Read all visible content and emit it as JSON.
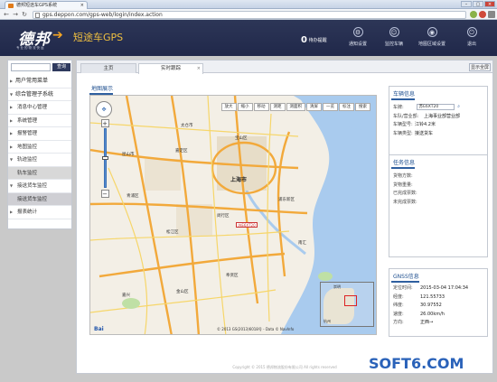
{
  "browser": {
    "tab_title": "德邦短途车GPS系统",
    "tab_close": "×",
    "url": "gps.deppon.com/gps-web/login/index.action",
    "window_buttons": [
      "–",
      "▢",
      "×"
    ],
    "nav": [
      "←",
      "→",
      "↻"
    ]
  },
  "header": {
    "logo": "德邦",
    "logo_sub": "专业的物流快运",
    "app_name": "短途车GPS",
    "notice_count": "0",
    "notice_label": "待办提醒",
    "items": [
      {
        "label": "通知设置",
        "icon": "bell-icon",
        "glyph": "⚙"
      },
      {
        "label": "监控车辆",
        "icon": "person-icon",
        "glyph": "👤"
      },
      {
        "label": "地图区域设置",
        "icon": "map-pin-icon",
        "glyph": "◉"
      },
      {
        "label": "退出",
        "icon": "power-icon",
        "glyph": "⏻"
      }
    ]
  },
  "sidebar": {
    "search_button": "查询",
    "items": [
      {
        "label": "用户常用菜单",
        "level": "parent",
        "arrow": "▶"
      },
      {
        "label": "综合管理子系统",
        "level": "parent",
        "arrow": "▼"
      },
      {
        "label": "消息中心管理",
        "level": "sub",
        "arrow": "▶"
      },
      {
        "label": "系统管理",
        "level": "sub",
        "arrow": "▶"
      },
      {
        "label": "报警管理",
        "level": "sub",
        "arrow": "▶"
      },
      {
        "label": "地图监控",
        "level": "sub",
        "arrow": "▶"
      },
      {
        "label": "轨迹监控",
        "level": "sub",
        "arrow": "▼"
      },
      {
        "label": "轨车监控",
        "level": "leaf-active",
        "arrow": ""
      },
      {
        "label": "接送货车监控",
        "level": "sub",
        "arrow": "▼"
      },
      {
        "label": "接送货车监控",
        "level": "leaf-active2",
        "arrow": ""
      },
      {
        "label": "报表统计",
        "level": "sub",
        "arrow": "▶"
      }
    ]
  },
  "content": {
    "tabs": [
      {
        "label": "主页",
        "active": false
      },
      {
        "label": "实时跟踪",
        "active": true
      }
    ],
    "tab_close": "×",
    "fullscreen": "显示全屏",
    "copyright": "Copyright © 2015 德邦物流股份有限公司 All rights reserved"
  },
  "map": {
    "title": "地图展示",
    "toolbar": [
      "放大",
      "缩小",
      "移动",
      "测距",
      "测面积",
      "清屏",
      "一览",
      "标注",
      "搜索"
    ],
    "pan_glyph": "✥",
    "zoom_in": "+",
    "zoom_out": "−",
    "places": [
      "上海市",
      "嘉定区",
      "宝山区",
      "青浦区",
      "松江区",
      "闵行区",
      "浦东新区",
      "奉贤区",
      "金山区",
      "南汇",
      "太仓市",
      "昆山市",
      "嘉兴",
      "崇明",
      "杭州"
    ],
    "marker": "苏E6XT20",
    "attribution": "© 2013 GS(2013)6018号 - Data © NavInfo",
    "logo": "Bai"
  },
  "vehicle_info": {
    "title": "车辆信息",
    "rows": [
      {
        "k": "车牌:",
        "v": "苏E6XT20"
      },
      {
        "k": "车队/营业部:",
        "v": "上海事业部营业部"
      },
      {
        "k": "车辆型号:",
        "v": "江铃4.2米"
      },
      {
        "k": "车辆类型:",
        "v": "接送货车"
      }
    ]
  },
  "task_info": {
    "title": "任务信息",
    "rows": [
      {
        "k": "货物方数:",
        "v": ""
      },
      {
        "k": "货物重量:",
        "v": ""
      },
      {
        "k": "已完成票数:",
        "v": ""
      },
      {
        "k": "未完成票数:",
        "v": ""
      }
    ]
  },
  "gnss_info": {
    "title": "GNSS信息",
    "rows": [
      {
        "k": "定位时间:",
        "v": "2015-03-04 17:04:34"
      },
      {
        "k": "经度:",
        "v": "121.55733"
      },
      {
        "k": "纬度:",
        "v": "30.97552"
      },
      {
        "k": "速度:",
        "v": "26.00km/h"
      },
      {
        "k": "方向:",
        "v": "正西→"
      }
    ]
  },
  "watermark": "SOFT6.COM"
}
